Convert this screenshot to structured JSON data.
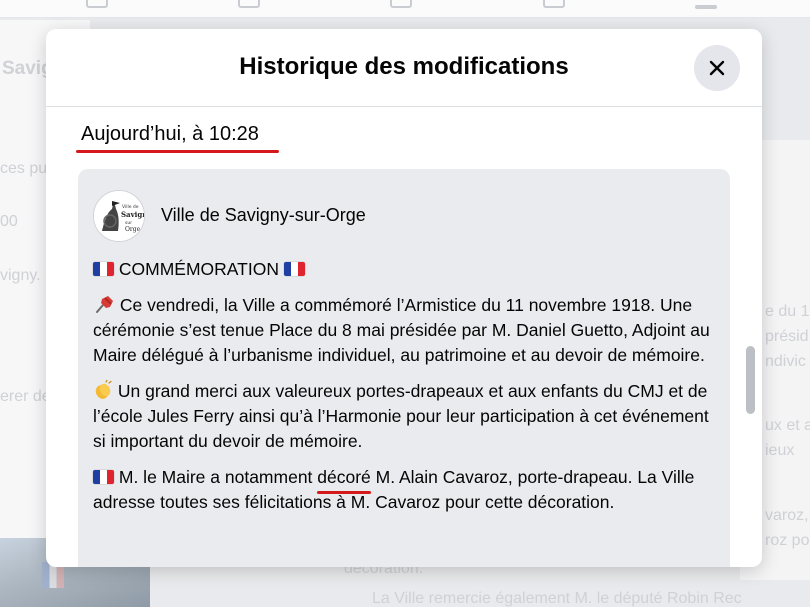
{
  "background": {
    "left_texts": [
      "Savig",
      "ces pu",
      "00",
      "vigny.",
      "erer de"
    ],
    "right_texts": [
      "e du 1",
      "présid",
      "ndivic",
      "ux et a",
      "ieux",
      "varoz,",
      "roz po"
    ],
    "bottom_texts": [
      "décoration.",
      "La Ville remercie également M. le député Robin Rec"
    ]
  },
  "modal": {
    "title": "Historique des modifications",
    "close_icon": "close-icon",
    "date_heading": "Aujourd’hui, à 10:28",
    "post": {
      "author": "Ville de Savigny-sur-Orge",
      "avatar_text": "Ville de Savigny sur Orge",
      "paragraphs": {
        "p1": "COMMÉMORATION",
        "p2": "Ce vendredi, la Ville a commémoré l’Armistice du 11 novembre 1918. Une cérémonie s’est tenue Place du 8 mai présidée par M. Daniel Guetto, Adjoint au Maire délégué à l’urbanisme individuel, au patrimoine et au devoir de mémoire.",
        "p3": "Un grand merci aux valeureux portes-drapeaux et aux enfants du CMJ et de l’école Jules Ferry ainsi qu’à l’Harmonie pour leur participation à cet événement si important du devoir de mémoire.",
        "p4_before": "M. le Maire a notamment ",
        "p4_highlight": "décoré",
        "p4_after": " M. Alain Cavaroz, porte-drapeau. La Ville adresse toutes ses félicitations à M. Cavaroz pour cette décoration."
      }
    },
    "colors": {
      "highlight_underline": "#d5191b",
      "card_bg": "#e9ebee"
    }
  }
}
